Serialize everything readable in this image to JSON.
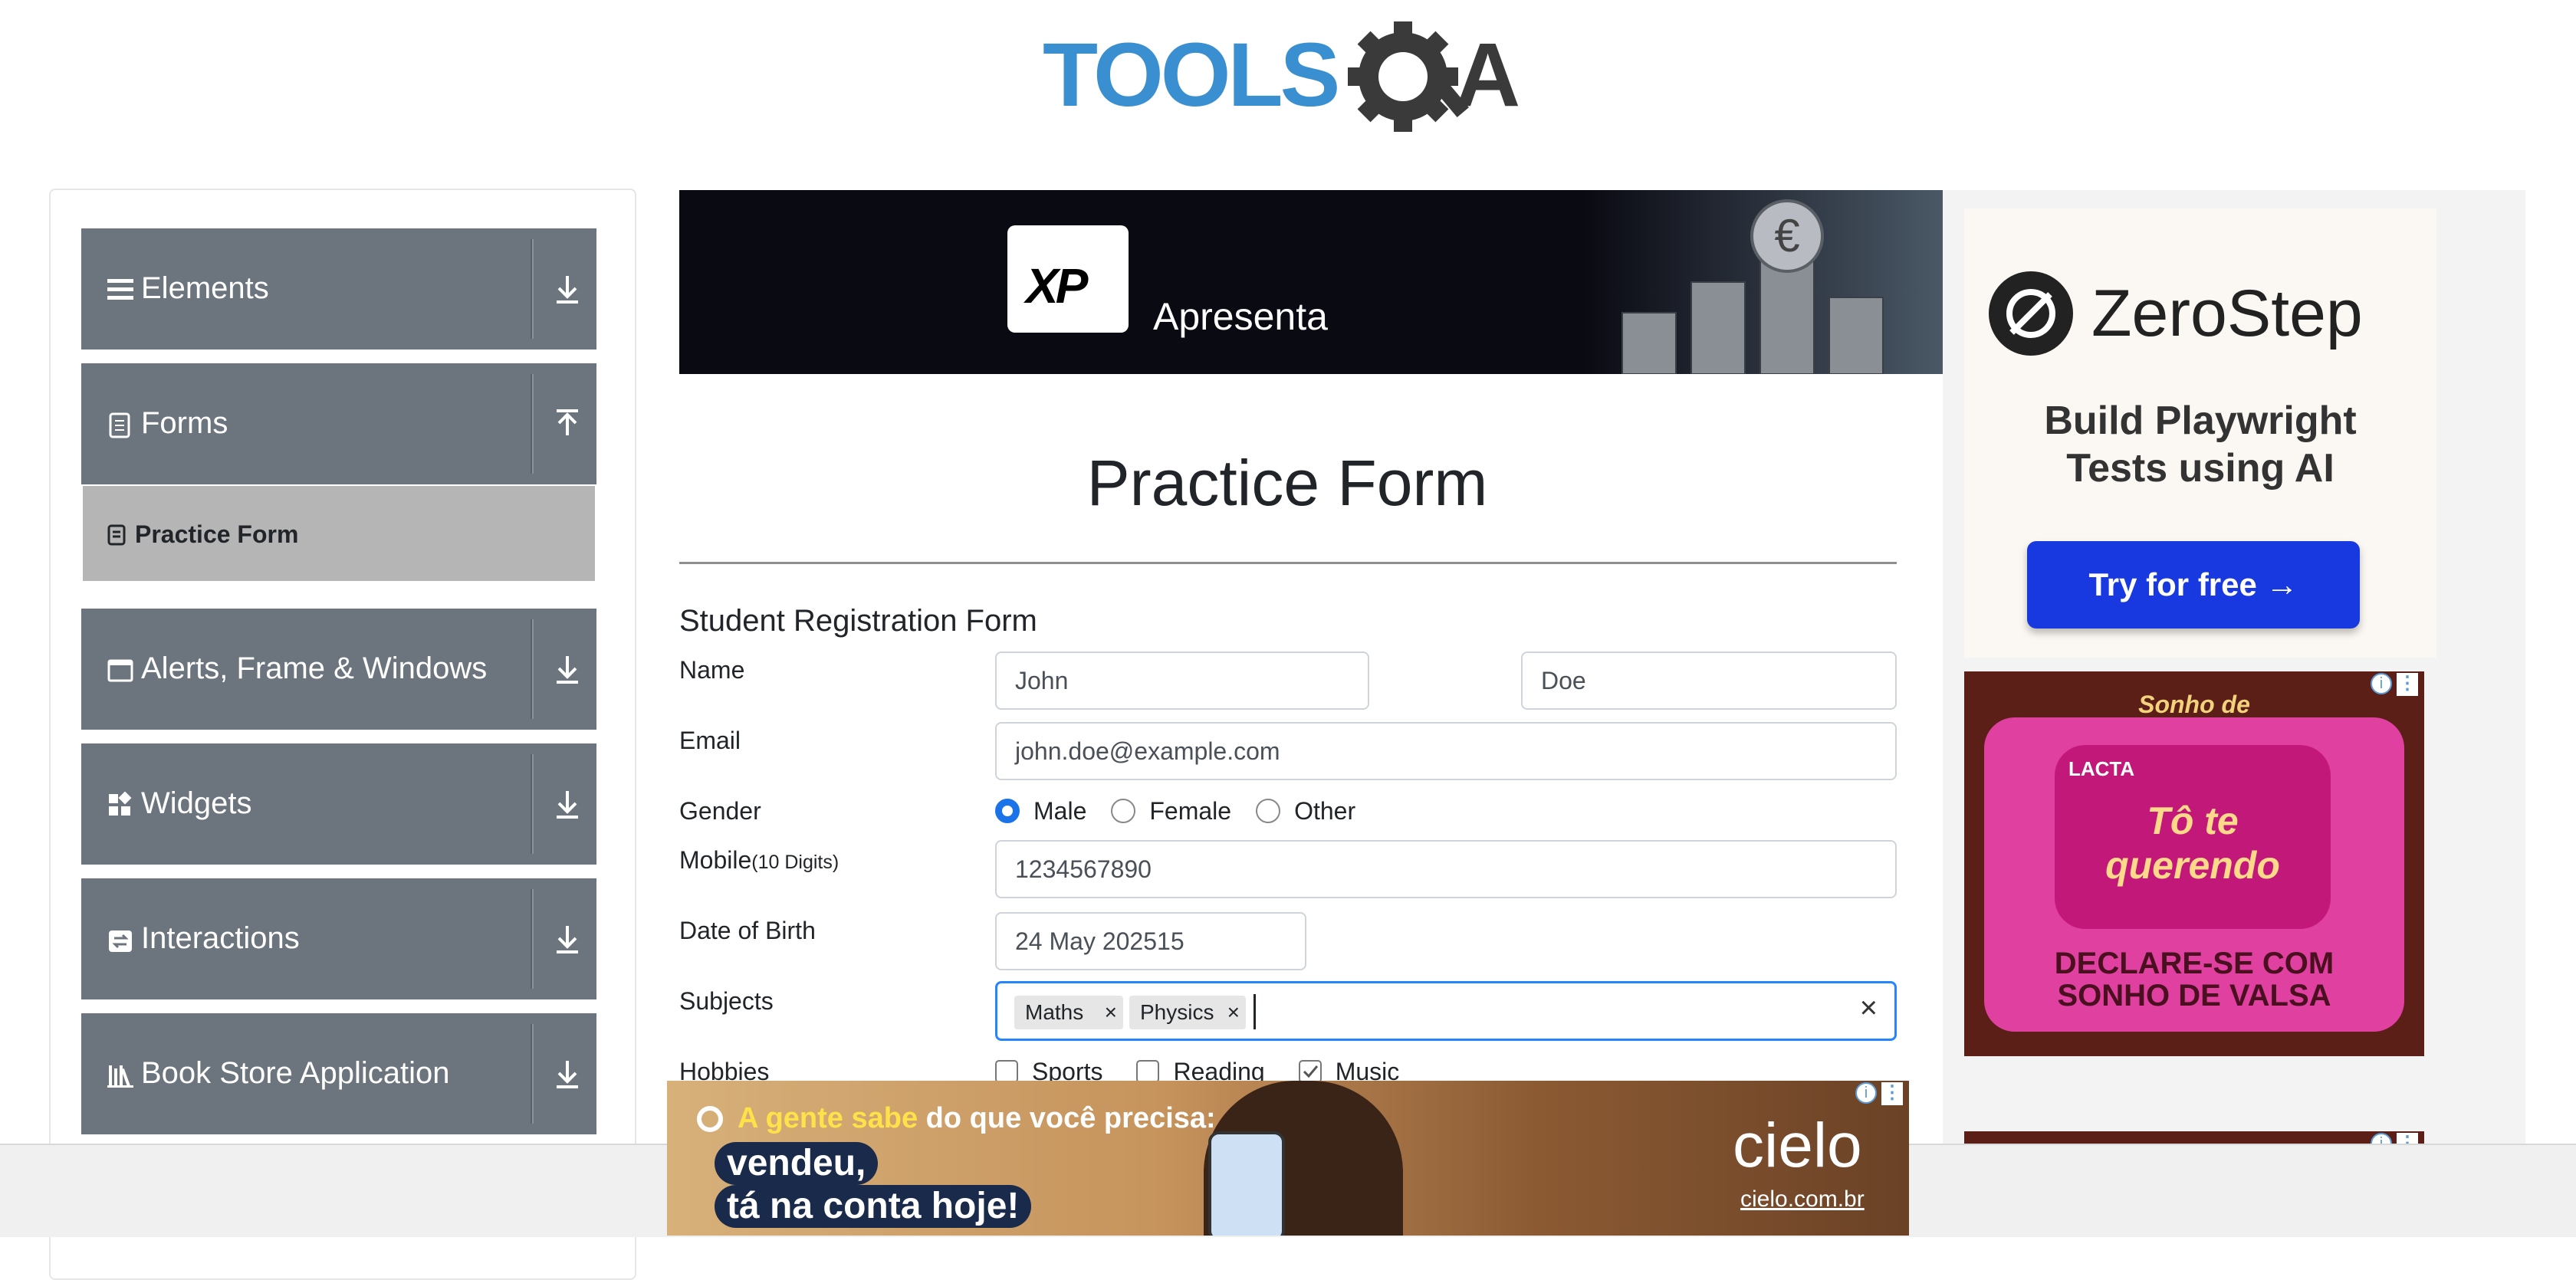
{
  "header": {
    "logo_text": "TOOLSQA"
  },
  "sidebar": {
    "groups": [
      {
        "label": "Elements",
        "icon": "hamburger-icon"
      },
      {
        "label": "Forms",
        "icon": "document-icon",
        "expanded": true
      },
      {
        "label": "Alerts, Frame & Windows",
        "icon": "window-icon"
      },
      {
        "label": "Widgets",
        "icon": "widgets-icon"
      },
      {
        "label": "Interactions",
        "icon": "interactions-icon"
      },
      {
        "label": "Book Store Application",
        "icon": "books-icon"
      }
    ],
    "active_item": "Practice Form"
  },
  "top_banner": {
    "brand": "XP",
    "text": "Apresenta"
  },
  "page": {
    "title": "Practice Form",
    "form_title": "Student Registration Form"
  },
  "form": {
    "name_label": "Name",
    "first_name": "John",
    "last_name": "Doe",
    "email_label": "Email",
    "email": "john.doe@example.com",
    "gender_label": "Gender",
    "gender_options": [
      "Male",
      "Female",
      "Other"
    ],
    "gender_selected": "Male",
    "mobile_label": "Mobile",
    "mobile_hint": "(10 Digits)",
    "mobile": "1234567890",
    "dob_label": "Date of Birth",
    "dob": "24 May 202515",
    "subjects_label": "Subjects",
    "subjects": [
      "Maths",
      "Physics"
    ],
    "hobbies_label": "Hobbies",
    "hobbies": [
      {
        "label": "Sports",
        "checked": false
      },
      {
        "label": "Reading",
        "checked": false
      },
      {
        "label": "Music",
        "checked": true
      }
    ]
  },
  "right_ad": {
    "brand": "ZeroStep",
    "tagline_1": "Build Playwright",
    "tagline_2": "Tests using AI",
    "cta": "Try for free →"
  },
  "candy_ad": {
    "brand": "Sonho de Valsa",
    "product": "Tô te querendo",
    "maker": "LACTA",
    "headline_1": "DECLARE-SE COM",
    "headline_2": "SONHO DE VALSA"
  },
  "bottom_ad": {
    "line_1a": "A gente sabe",
    "line_1b": " do que você precisa:",
    "line_2": "vendeu,",
    "line_3": "tá na conta hoje!",
    "brand": "cielo",
    "url": "cielo.com.br"
  },
  "colors": {
    "sidebar_group": "#6c757d",
    "active_item": "#b5b5b5",
    "focus": "#2684ff",
    "logo_blue": "#3a8fd0",
    "logo_dark": "#3a3a3a"
  }
}
